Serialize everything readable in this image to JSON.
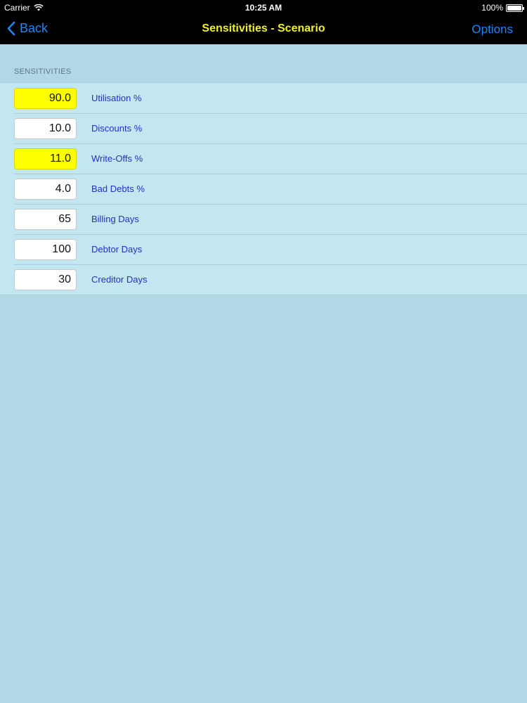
{
  "status_bar": {
    "carrier": "Carrier",
    "time": "10:25 AM",
    "battery": "100%",
    "wifi_icon": "wifi-icon",
    "battery_icon": "battery-icon",
    "battery_level": 1.0
  },
  "nav": {
    "back_label": "Back",
    "back_icon": "chevron-left-icon",
    "title": "Sensitivities - Scenario",
    "options_label": "Options",
    "accent_color": "#1e86f2",
    "title_color": "#f2f21e"
  },
  "section": {
    "header": "SENSITIVITIES"
  },
  "rows": [
    {
      "value": "90.0",
      "label": "Utilisation %",
      "highlight": true
    },
    {
      "value": "10.0",
      "label": "Discounts %",
      "highlight": false
    },
    {
      "value": "11.0",
      "label": "Write-Offs %",
      "highlight": true
    },
    {
      "value": "4.0",
      "label": "Bad Debts %",
      "highlight": false
    },
    {
      "value": "65",
      "label": "Billing Days",
      "highlight": false
    },
    {
      "value": "100",
      "label": "Debtor Days",
      "highlight": false
    },
    {
      "value": "30",
      "label": "Creditor Days",
      "highlight": false
    }
  ],
  "colors": {
    "highlight": "#ffff00",
    "label": "#2230c8",
    "background": "#b1d8e6",
    "row_background": "#c3e7f0"
  }
}
